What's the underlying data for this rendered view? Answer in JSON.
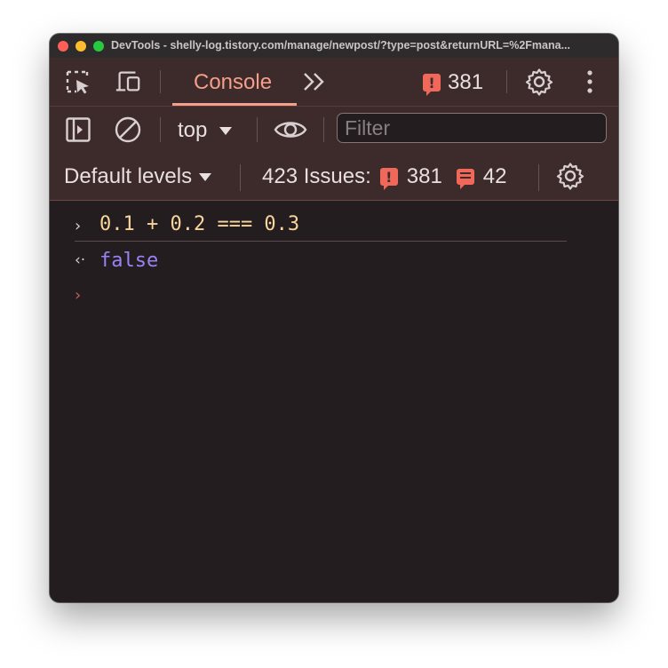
{
  "window": {
    "title": "DevTools - shelly-log.tistory.com/manage/newpost/?type=post&returnURL=%2Fmana..."
  },
  "toolbar": {
    "inspect_icon": "inspect-element-icon",
    "device_icon": "device-toolbar-icon",
    "active_tab": "Console",
    "more_tabs_icon": "double-chevron-right-icon",
    "error_count": "381",
    "settings_icon": "gear-icon",
    "menu_icon": "vertical-dots-icon"
  },
  "console_toolbar": {
    "sidebar_icon": "sidebar-toggle-icon",
    "clear_icon": "clear-console-icon",
    "context": "top",
    "eye_icon": "eye-icon",
    "filter_placeholder": "Filter"
  },
  "levels_bar": {
    "levels_label": "Default levels",
    "issues_label": "423 Issues:",
    "error_issues": "381",
    "info_issues": "42"
  },
  "console": {
    "input_expression": "0.1 + 0.2 === 0.3",
    "output_value": "false"
  },
  "colors": {
    "accent": "#f59f8b",
    "toolbar_bg": "#3d2a2a",
    "console_bg": "#231d1f",
    "code_color": "#f8d59b",
    "result_color": "#9a82f5",
    "error_badge": "#f0685a"
  }
}
